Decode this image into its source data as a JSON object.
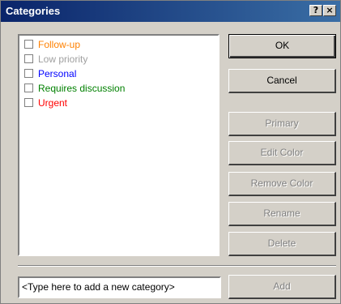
{
  "window": {
    "title": "Categories",
    "help_label": "?",
    "close_label": "×"
  },
  "categories": [
    {
      "label": "Follow-up",
      "color": "#ff8000",
      "checked": false
    },
    {
      "label": "Low priority",
      "color": "#a0a0a0",
      "checked": false
    },
    {
      "label": "Personal",
      "color": "#0000ff",
      "checked": false
    },
    {
      "label": "Requires discussion",
      "color": "#008000",
      "checked": false
    },
    {
      "label": "Urgent",
      "color": "#ff0000",
      "checked": false
    }
  ],
  "buttons": {
    "ok": "OK",
    "cancel": "Cancel",
    "primary": "Primary",
    "edit_color": "Edit Color",
    "remove_color": "Remove Color",
    "rename": "Rename",
    "delete": "Delete",
    "add": "Add"
  },
  "new_category": {
    "placeholder": "<Type here to add a new category>"
  }
}
